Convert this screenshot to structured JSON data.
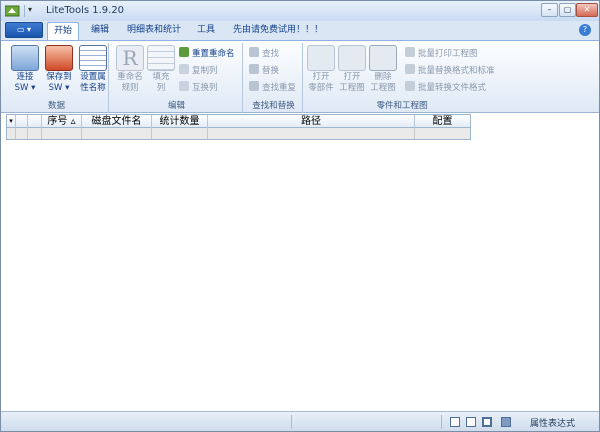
{
  "window": {
    "title": "LiteTools 1.9.20",
    "minimize": "–",
    "maximize": "▢",
    "close": "✕"
  },
  "quick_access": {
    "dropdown": "▾"
  },
  "app_menu": {
    "label": "▾"
  },
  "tabs": [
    {
      "label": "开始"
    },
    {
      "label": "编辑"
    },
    {
      "label": "明细表和统计"
    },
    {
      "label": "工具"
    },
    {
      "label": "先由请免费试用！！！"
    }
  ],
  "help": "?",
  "ribbon": {
    "data_group": {
      "label": "数据",
      "connect": "连接\nSW ▾",
      "save": "保存到\nSW ▾",
      "set_attr": "设置属\n性名称"
    },
    "edit_group": {
      "label": "编辑",
      "rename_rule": "重命名\n规则",
      "fill_col": "填充\n列",
      "reset_rename": "重置重命名",
      "copy_col": "复制列",
      "swap_col": "互换列"
    },
    "find_group": {
      "label": "查找和替换",
      "find": "查找",
      "replace": "替换",
      "find_dup": "查找重复"
    },
    "parts_group": {
      "label": "零件和工程图",
      "open_part": "打开\n零部件",
      "open_drawing": "打开\n工程图",
      "delete_drawing": "删除\n工程图",
      "batch_print": "批量打印工程图",
      "batch_replace": "批量替换格式和标准",
      "batch_convert": "批量转换文件格式"
    }
  },
  "grid": {
    "columns": [
      {
        "label": "序号 ▵"
      },
      {
        "label": "磁盘文件名"
      },
      {
        "label": "统计数量"
      },
      {
        "label": "路径"
      },
      {
        "label": "配置"
      }
    ]
  },
  "statusbar": {
    "text": "属性表达式"
  },
  "colors": {
    "accent": "#15428b",
    "ribbon_bg": "#dfe9f5",
    "tab_bar": "#dbe6f4"
  }
}
